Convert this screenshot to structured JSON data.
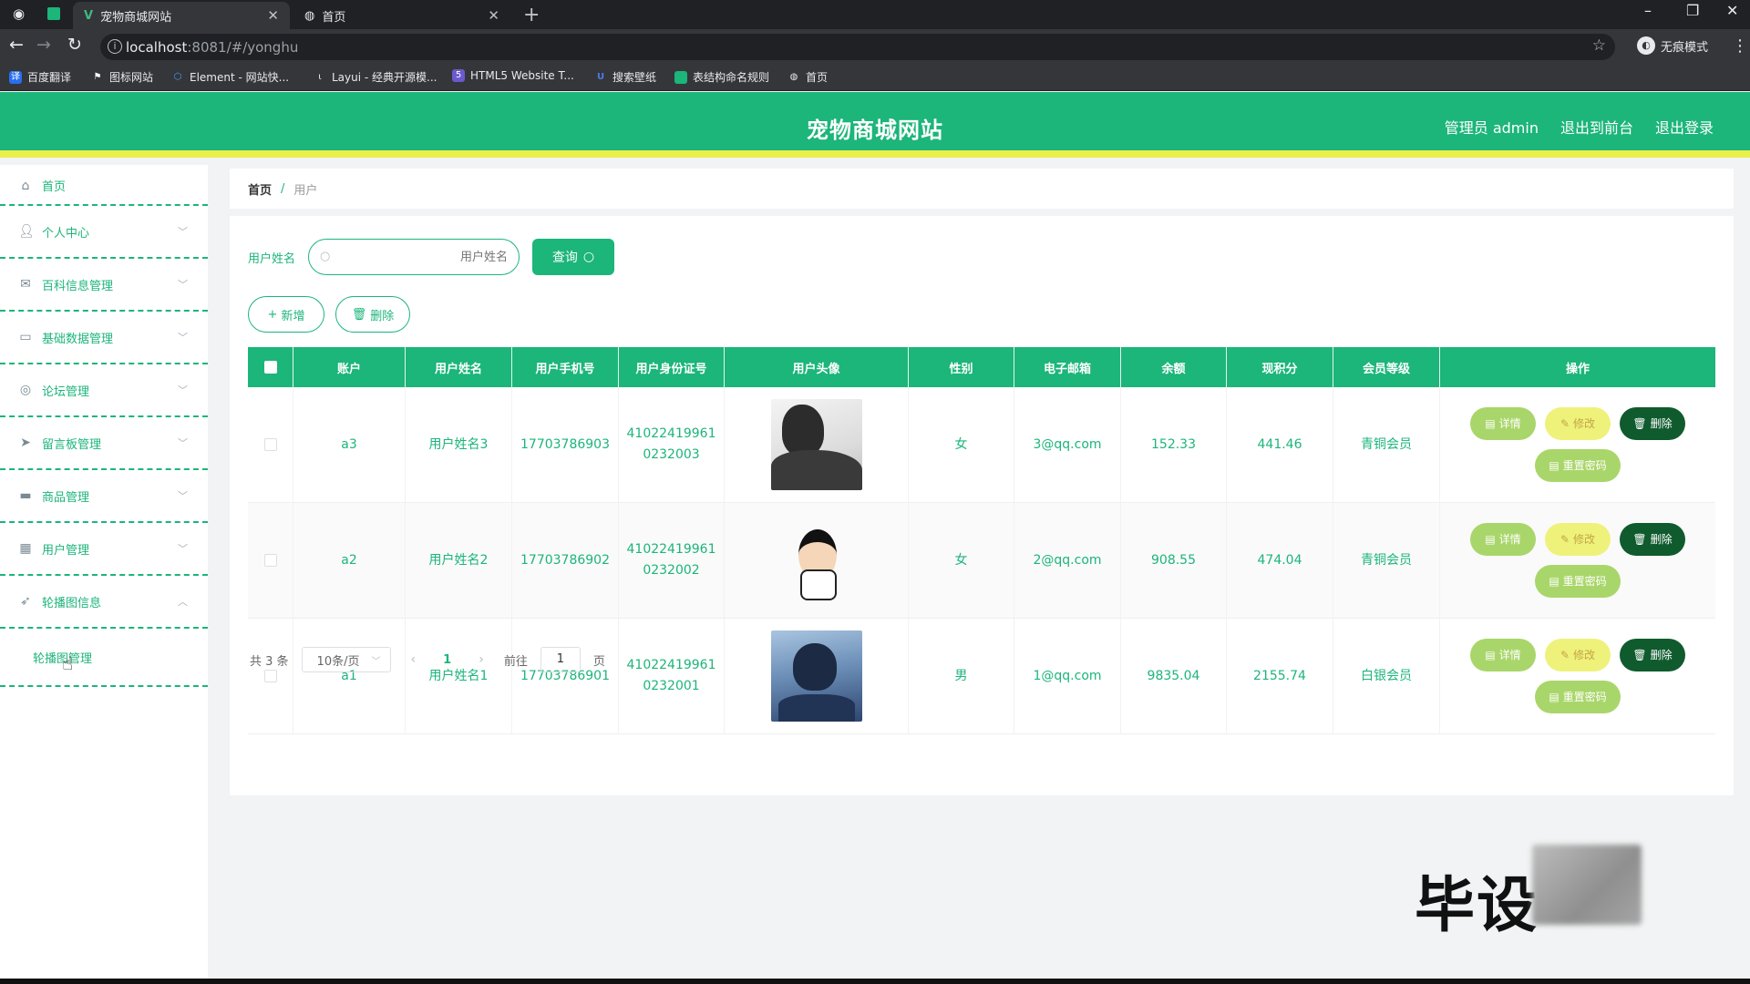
{
  "browser": {
    "tabs": [
      {
        "title": "宠物商城网站",
        "active": true
      },
      {
        "title": "首页",
        "active": false
      }
    ],
    "url_host": "localhost",
    "url_rest": ":8081/#/yonghu",
    "profile_label": "无痕模式",
    "bookmarks": [
      "百度翻译",
      "图标网站",
      "Element - 网站快...",
      "Layui - 经典开源模...",
      "HTML5 Website T...",
      "搜索壁纸",
      "表结构命名规则",
      "首页"
    ]
  },
  "header": {
    "title": "宠物商城网站",
    "links": [
      "管理员 admin",
      "退出到前台",
      "退出登录"
    ]
  },
  "sidebar": {
    "items": [
      {
        "label": "首页",
        "icon": "home-icon",
        "expandable": false
      },
      {
        "label": "个人中心",
        "icon": "user-icon",
        "expandable": true
      },
      {
        "label": "百科信息管理",
        "icon": "mail-icon",
        "expandable": true
      },
      {
        "label": "基础数据管理",
        "icon": "chat-icon",
        "expandable": true
      },
      {
        "label": "论坛管理",
        "icon": "compass-icon",
        "expandable": true
      },
      {
        "label": "留言板管理",
        "icon": "send-icon",
        "expandable": true
      },
      {
        "label": "商品管理",
        "icon": "ticket-icon",
        "expandable": true
      },
      {
        "label": "用户管理",
        "icon": "grid-icon",
        "expandable": true
      },
      {
        "label": "轮播图信息",
        "icon": "location-icon",
        "expandable": true,
        "expanded": true
      }
    ],
    "sub_item": "轮播图管理"
  },
  "breadcrumb": {
    "home": "首页",
    "separator": "/",
    "current": "用户"
  },
  "search": {
    "label": "用户姓名",
    "placeholder": "用户姓名",
    "value": "",
    "button": "查询"
  },
  "actions": {
    "add": "新增",
    "delete": "删除"
  },
  "table": {
    "columns": [
      "账户",
      "用户姓名",
      "用户手机号",
      "用户身份证号",
      "用户头像",
      "性别",
      "电子邮箱",
      "余额",
      "现积分",
      "会员等级",
      "操作"
    ],
    "rows": [
      {
        "account": "a3",
        "name": "用户姓名3",
        "phone": "17703786903",
        "id_line1": "41022419961",
        "id_line2": "0232003",
        "gender": "女",
        "email": "3@qq.com",
        "balance": "152.33",
        "points": "441.46",
        "level": "青铜会员"
      },
      {
        "account": "a2",
        "name": "用户姓名2",
        "phone": "17703786902",
        "id_line1": "41022419961",
        "id_line2": "0232002",
        "gender": "女",
        "email": "2@qq.com",
        "balance": "908.55",
        "points": "474.04",
        "level": "青铜会员"
      },
      {
        "account": "a1",
        "name": "用户姓名1",
        "phone": "17703786901",
        "id_line1": "41022419961",
        "id_line2": "0232001",
        "gender": "男",
        "email": "1@qq.com",
        "balance": "9835.04",
        "points": "2155.74",
        "level": "白银会员"
      }
    ],
    "row_actions": {
      "detail": "详情",
      "edit": "修改",
      "delete": "删除",
      "reset": "重置密码"
    }
  },
  "pagination": {
    "total": "共 3 条",
    "page_size": "10条/页",
    "current": "1",
    "goto_prefix": "前往",
    "goto_value": "1",
    "goto_suffix": "页"
  },
  "watermark": "毕设",
  "colors": {
    "primary": "#1cb57a",
    "accent_bar": "#e9f04a",
    "delete_dark": "#0f5b2e",
    "detail_green": "#a9d66a",
    "edit_yellow": "#eef27a"
  }
}
